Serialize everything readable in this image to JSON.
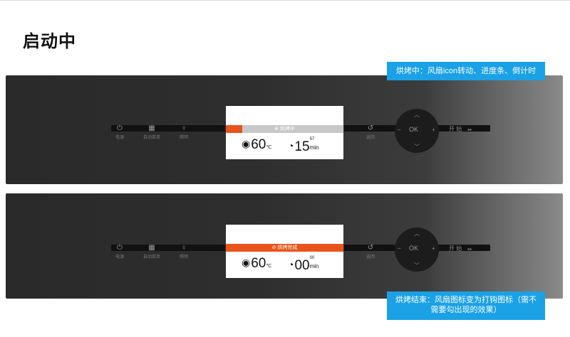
{
  "page_title": "启动中",
  "annotations": {
    "baking": "烘烤中：风扇icon转动、进度条、倒计时",
    "finished": "烘烤结束：风扇图标变为打钩图标（需不需要勾出现的效果）"
  },
  "panel_controls": {
    "power": {
      "icon": "power-icon",
      "label": "电源"
    },
    "auto_menu": {
      "icon": "menu-icon",
      "label": "自动菜单"
    },
    "light": {
      "icon": "light-icon",
      "label": "照明"
    },
    "back": {
      "icon": "back-arrow-icon",
      "label": "返回"
    },
    "ok": "OK",
    "minus": "−",
    "plus": "+",
    "up": "︿",
    "down": "﹀",
    "start": "开 始",
    "start_arrows": "▸▸"
  },
  "screen_baking": {
    "status_icon": "fan-icon",
    "status_text": "烘烤中",
    "progress": 0.14,
    "temperature": "60",
    "temp_unit": "℃",
    "minutes": "15",
    "seconds": "57",
    "time_unit": "min"
  },
  "screen_finished": {
    "status_icon": "check-icon",
    "status_text": "烘烤完成",
    "progress": 1.0,
    "temperature": "60",
    "temp_unit": "℃",
    "minutes": "00",
    "seconds": "00",
    "time_unit": "min"
  },
  "colors": {
    "accent_orange": "#e8541c",
    "note_blue": "#1aa1e6",
    "panel_dark": "#2a2a2a"
  }
}
